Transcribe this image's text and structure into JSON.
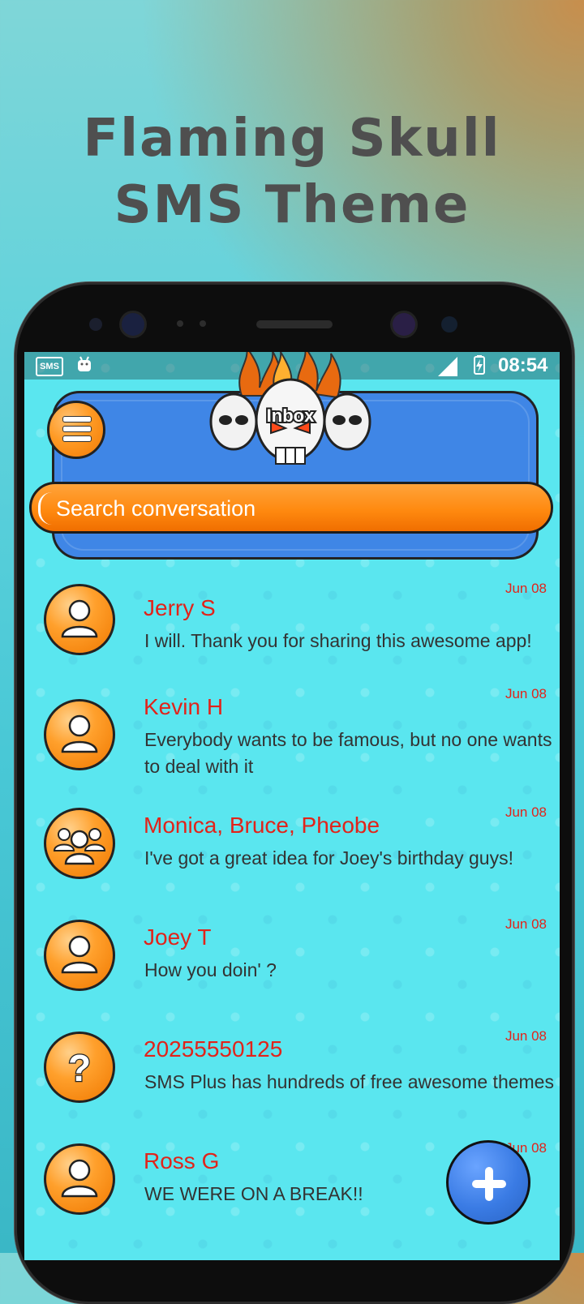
{
  "promo": {
    "title_line1": "Flaming Skull",
    "title_line2": "SMS Theme"
  },
  "status_bar": {
    "left_icons": [
      "sms-app-icon",
      "android-icon"
    ],
    "right_icons": [
      "signal-icon",
      "battery-charging-icon"
    ],
    "time": "08:54",
    "sms_label": "SMS"
  },
  "header": {
    "title": "Inbox",
    "menu_icon": "hamburger-menu-icon",
    "search_placeholder": "Search conversation"
  },
  "conversations": [
    {
      "name": "Jerry S",
      "preview": "I will. Thank you for sharing this awesome app!",
      "date": "Jun 08",
      "avatar": "person-icon"
    },
    {
      "name": "Kevin H",
      "preview": "Everybody wants to be famous, but no one wants to deal with it",
      "date": "Jun 08",
      "avatar": "person-icon"
    },
    {
      "name": "Monica, Bruce, Pheobe",
      "preview": "I've got a great idea for Joey's birthday guys!",
      "date": "Jun 08",
      "avatar": "group-icon"
    },
    {
      "name": "Joey T",
      "preview": "How you doin' ?",
      "date": "Jun 08",
      "avatar": "person-icon"
    },
    {
      "name": "20255550125",
      "preview": "SMS Plus has hundreds of free awesome themes",
      "date": "Jun 08",
      "avatar": "unknown-contact-icon"
    },
    {
      "name": "Ross G",
      "preview": "WE WERE ON A BREAK!!",
      "date": "Jun 08",
      "avatar": "person-icon"
    }
  ],
  "fab": {
    "icon": "plus-icon"
  },
  "colors": {
    "screen_background": "#5ae6ef",
    "header_panel": "#3f86e6",
    "accent_orange": "#ff8a10",
    "contact_name": "#e2231a",
    "fab_blue": "#3a7be4"
  }
}
